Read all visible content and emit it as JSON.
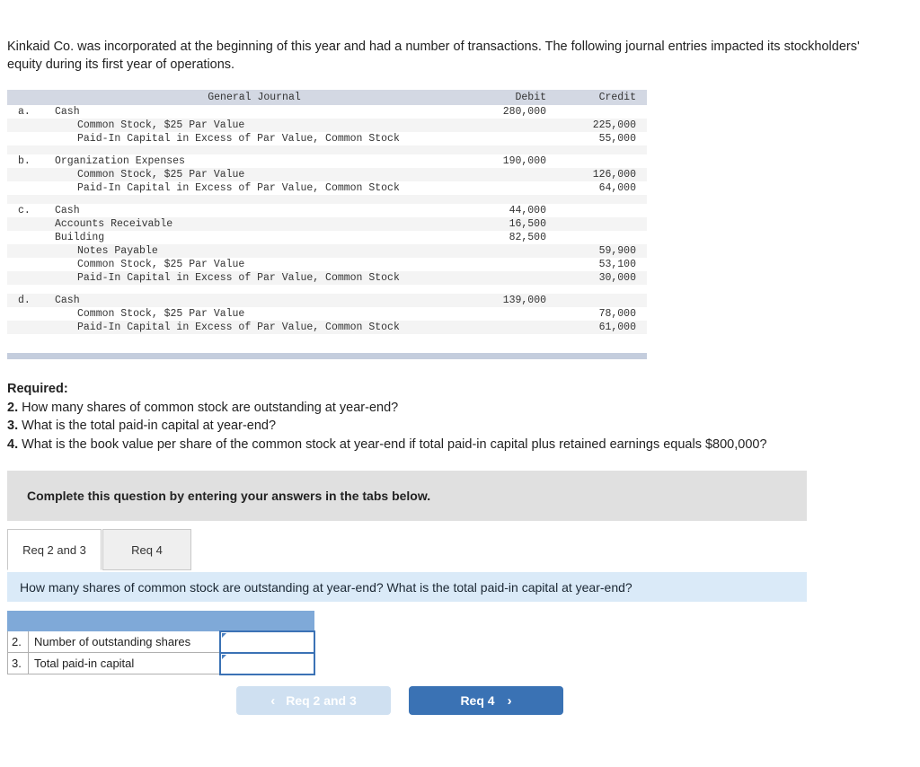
{
  "intro": "Kinkaid Co. was incorporated at the beginning of this year and had a number of transactions. The following journal entries impacted its stockholders' equity during its first year of operations.",
  "journal": {
    "headers": {
      "general_journal": "General Journal",
      "debit": "Debit",
      "credit": "Credit"
    },
    "entries": [
      {
        "letter": "a.",
        "lines": [
          {
            "account": "Cash",
            "indent": 0,
            "debit": "280,000",
            "credit": ""
          },
          {
            "account": "Common Stock, $25 Par Value",
            "indent": 1,
            "debit": "",
            "credit": "225,000"
          },
          {
            "account": "Paid-In Capital in Excess of Par Value, Common Stock",
            "indent": 1,
            "debit": "",
            "credit": "55,000"
          }
        ]
      },
      {
        "letter": "b.",
        "lines": [
          {
            "account": "Organization Expenses",
            "indent": 0,
            "debit": "190,000",
            "credit": ""
          },
          {
            "account": "Common Stock, $25 Par Value",
            "indent": 1,
            "debit": "",
            "credit": "126,000"
          },
          {
            "account": "Paid-In Capital in Excess of Par Value, Common Stock",
            "indent": 1,
            "debit": "",
            "credit": "64,000"
          }
        ]
      },
      {
        "letter": "c.",
        "lines": [
          {
            "account": "Cash",
            "indent": 0,
            "debit": "44,000",
            "credit": ""
          },
          {
            "account": "Accounts Receivable",
            "indent": 0,
            "debit": "16,500",
            "credit": ""
          },
          {
            "account": "Building",
            "indent": 0,
            "debit": "82,500",
            "credit": ""
          },
          {
            "account": "Notes Payable",
            "indent": 1,
            "debit": "",
            "credit": "59,900"
          },
          {
            "account": "Common Stock, $25 Par Value",
            "indent": 1,
            "debit": "",
            "credit": "53,100"
          },
          {
            "account": "Paid-In Capital in Excess of Par Value, Common Stock",
            "indent": 1,
            "debit": "",
            "credit": "30,000"
          }
        ]
      },
      {
        "letter": "d.",
        "lines": [
          {
            "account": "Cash",
            "indent": 0,
            "debit": "139,000",
            "credit": ""
          },
          {
            "account": "Common Stock, $25 Par Value",
            "indent": 1,
            "debit": "",
            "credit": "78,000"
          },
          {
            "account": "Paid-In Capital in Excess of Par Value, Common Stock",
            "indent": 1,
            "debit": "",
            "credit": "61,000"
          }
        ]
      }
    ]
  },
  "required": {
    "title": "Required:",
    "items": [
      {
        "num": "2.",
        "text": " How many shares of common stock are outstanding at year-end?"
      },
      {
        "num": "3.",
        "text": " What is the total paid-in capital at year-end?"
      },
      {
        "num": "4.",
        "text": " What is the book value per share of the common stock at year-end if total paid-in capital plus retained earnings equals $800,000?"
      }
    ]
  },
  "instruction": "Complete this question by entering your answers in the tabs below.",
  "tabs": [
    {
      "label": "Req 2 and 3",
      "active": true
    },
    {
      "label": "Req 4",
      "active": false
    }
  ],
  "question_bar": "How many shares of common stock are outstanding at year-end? What is the total paid-in capital at year-end?",
  "answer_table": {
    "rows": [
      {
        "num": "2.",
        "label": "Number of outstanding shares",
        "value": ""
      },
      {
        "num": "3.",
        "label": "Total paid-in capital",
        "value": ""
      }
    ]
  },
  "nav": {
    "prev_label": "Req 2 and 3",
    "prev_icon": "chevron-left-icon",
    "prev_chevron": "‹",
    "next_label": "Req 4",
    "next_icon": "chevron-right-icon",
    "next_chevron": "›"
  },
  "colors": {
    "journal_header_bg": "#d3d8e3",
    "journal_footer_bg": "#c4cddd",
    "instruction_bg": "#e0e0e0",
    "question_bar_bg": "#daeaf8",
    "answer_header_bg": "#7fa9d8",
    "button_primary": "#3a72b4",
    "button_disabled": "#cfe0f1"
  }
}
